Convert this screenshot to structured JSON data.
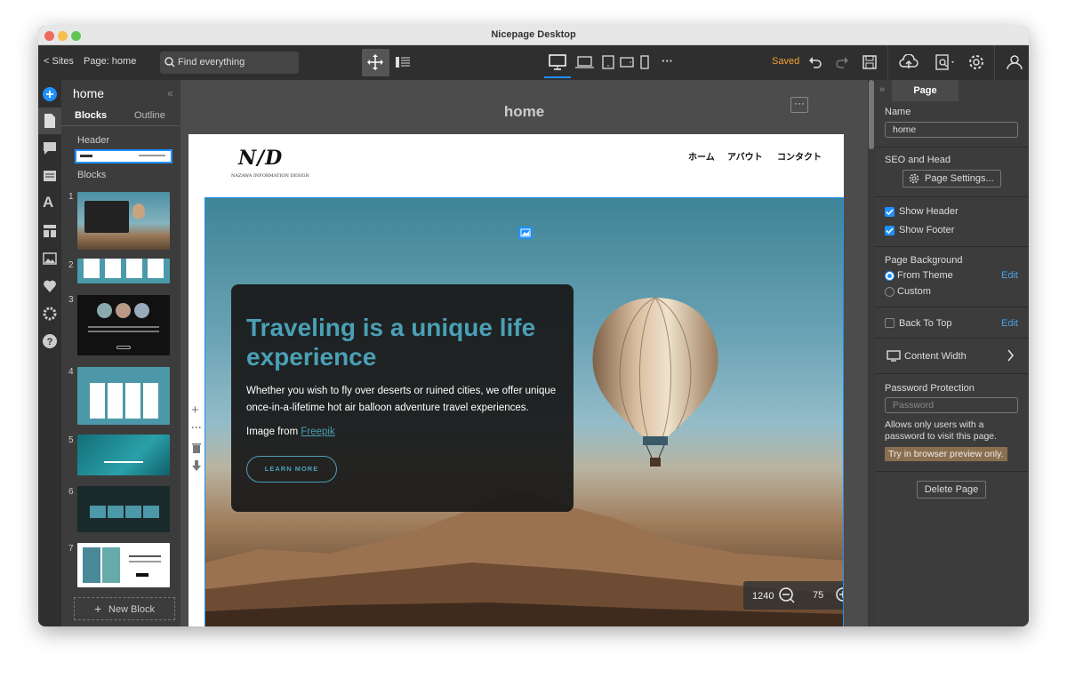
{
  "window": {
    "title": "Nicepage Desktop"
  },
  "toolbar": {
    "sites": "< Sites",
    "page": "Page: home",
    "search_placeholder": "Find everything",
    "saved": "Saved"
  },
  "left_panel": {
    "title": "home",
    "tabs": [
      "Blocks",
      "Outline"
    ],
    "header_label": "Header",
    "blocks_label": "Blocks",
    "block_numbers": [
      "1",
      "2",
      "3",
      "4",
      "5",
      "6",
      "7"
    ],
    "new_block": "New Block"
  },
  "canvas": {
    "page_title": "home",
    "nav": [
      "ホーム",
      "アバウト",
      "コンタクト"
    ],
    "logo_text": "N/D",
    "logo_subtext": "NAZAWA INFORMATION DESIGN",
    "hero": {
      "heading": "Traveling is a unique life experience",
      "body": "Whether you wish to fly over deserts or ruined cities, we offer unique once-in-a-lifetime hot air balloon adventure travel experiences.",
      "image_from": "Image from",
      "link": "Freepik",
      "button": "LEARN MORE"
    },
    "zoom": {
      "width": "1240",
      "level": "75"
    }
  },
  "right_panel": {
    "tab": "Page",
    "name_label": "Name",
    "name_value": "home",
    "seo_label": "SEO and Head",
    "page_settings": "Page Settings...",
    "show_header": "Show Header",
    "show_footer": "Show Footer",
    "bg_label": "Page Background",
    "from_theme": "From Theme",
    "custom": "Custom",
    "edit": "Edit",
    "back_to_top": "Back To Top",
    "content_width": "Content Width",
    "password_label": "Password Protection",
    "password_placeholder": "Password",
    "password_note": "Allows only users with a password to visit this page.",
    "preview_note": "Try in browser preview only.",
    "delete": "Delete Page"
  },
  "colors": {
    "accent": "#1e90ff",
    "saved": "#f0a030",
    "heading": "#4aa0b5",
    "hero_button": "#4aa0b5"
  }
}
